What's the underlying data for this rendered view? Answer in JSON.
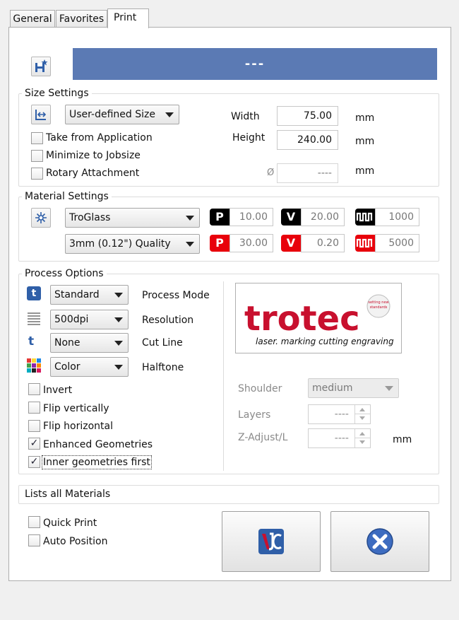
{
  "tabs": [
    {
      "label": "General"
    },
    {
      "label": "Favorites"
    },
    {
      "label": "Print"
    }
  ],
  "job_name": "---",
  "size_settings": {
    "legend": "Size Settings",
    "size_select": "User-defined Size",
    "take_from_application": "Take from Application",
    "minimize_to_jobsize": "Minimize to Jobsize",
    "rotary_attachment": "Rotary Attachment",
    "width_label": "Width",
    "width_value": "75.00",
    "height_label": "Height",
    "height_value": "240.00",
    "diameter_symbol": "Ø",
    "diameter_value": "----",
    "unit": "mm"
  },
  "material_settings": {
    "legend": "Material Settings",
    "material": "TroGlass",
    "quality": "3mm (0.12\") Quality",
    "engrave": {
      "power": "10.00",
      "velocity": "20.00",
      "ppi": "1000"
    },
    "cut": {
      "power": "30.00",
      "velocity": "0.20",
      "frequency": "5000"
    },
    "badge_p": "P",
    "badge_v": "V",
    "colors": {
      "engrave": "#000000",
      "cut": "#e8000b"
    }
  },
  "process_options": {
    "legend": "Process Options",
    "process_mode": {
      "value": "Standard",
      "label": "Process Mode"
    },
    "resolution": {
      "value": "500dpi",
      "label": "Resolution"
    },
    "cut_line": {
      "value": "None",
      "label": "Cut Line"
    },
    "halftone": {
      "value": "Color",
      "label": "Halftone"
    },
    "checkboxes": [
      {
        "label": "Invert",
        "checked": false
      },
      {
        "label": "Flip vertically",
        "checked": false
      },
      {
        "label": "Flip horizontal",
        "checked": false
      },
      {
        "label": "Enhanced Geometries",
        "checked": true
      },
      {
        "label": "Inner geometries first",
        "checked": true
      }
    ],
    "logo": {
      "brand": "trotec",
      "tagline": "laser. marking cutting engraving",
      "seal": "setting new standards"
    },
    "shoulder_label": "Shoulder",
    "shoulder_value": "medium",
    "layers_label": "Layers",
    "layers_value": "----",
    "z_adjust_label": "Z-Adjust/L",
    "z_adjust_value": "----",
    "unit": "mm"
  },
  "status": "Lists all Materials",
  "quick_print": "Quick Print",
  "auto_position": "Auto Position",
  "check_mark": "✓",
  "colors": {
    "banner": "#5b7ab4",
    "brand_red": "#c8102e",
    "accent_blue": "#2f5fa8"
  }
}
